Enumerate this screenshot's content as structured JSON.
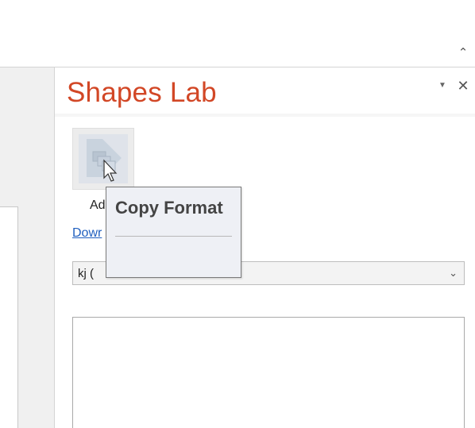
{
  "pane": {
    "title": "Shapes Lab",
    "options_icon": "triangle-down-icon",
    "close_icon": "close-icon"
  },
  "ribbon": {
    "collapse_icon": "chevron-up-icon"
  },
  "feature": {
    "icon": "copy-format-icon",
    "label": "Ad",
    "link": "Dowr"
  },
  "dropdown": {
    "value": "kj (",
    "arrow_icon": "chevron-down-icon"
  },
  "tooltip": {
    "title": "Copy Format"
  },
  "colors": {
    "title_accent": "#d24726",
    "link": "#1f5fbf",
    "tooltip_bg": "#eef0f5"
  }
}
